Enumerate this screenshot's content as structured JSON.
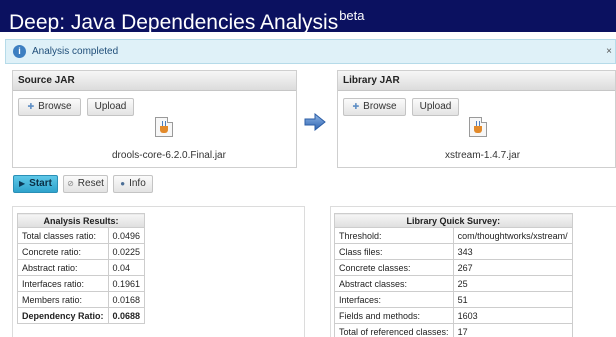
{
  "header": {
    "title": "Deep: Java Dependencies Analysis",
    "badge": "beta"
  },
  "notice": {
    "message": "Analysis completed",
    "close": "×"
  },
  "source_panel": {
    "title": "Source JAR",
    "browse_label": "Browse",
    "upload_label": "Upload",
    "file_name": "drools-core-6.2.0.Final.jar"
  },
  "library_panel": {
    "title": "Library JAR",
    "browse_label": "Browse",
    "upload_label": "Upload",
    "file_name": "xstream-1.4.7.jar"
  },
  "actions": {
    "start_label": "Start",
    "reset_label": "Reset",
    "info_label": "Info"
  },
  "results": {
    "title": "Analysis Results:",
    "rows": [
      {
        "label": "Total classes ratio:",
        "value": "0.0496"
      },
      {
        "label": "Concrete ratio:",
        "value": "0.0225"
      },
      {
        "label": "Abstract ratio:",
        "value": "0.04"
      },
      {
        "label": "Interfaces ratio:",
        "value": "0.1961"
      },
      {
        "label": "Members ratio:",
        "value": "0.0168"
      },
      {
        "label": "Dependency Ratio:",
        "value": "0.0688"
      }
    ]
  },
  "survey": {
    "title": "Library Quick Survey:",
    "rows": [
      {
        "label": "Threshold:",
        "value": "com/thoughtworks/xstream/"
      },
      {
        "label": "Class files:",
        "value": "343"
      },
      {
        "label": "Concrete classes:",
        "value": "267"
      },
      {
        "label": "Abstract classes:",
        "value": "25"
      },
      {
        "label": "Interfaces:",
        "value": "51"
      },
      {
        "label": "Fields and methods:",
        "value": "1603"
      },
      {
        "label": "Total of referenced classes:",
        "value": "17"
      }
    ]
  },
  "icons": {
    "info": "info-icon",
    "arrow": "arrow-right-icon",
    "jar": "java-jar-file-icon",
    "plus": "plus-icon",
    "play": "play-icon",
    "reset": "reset-icon"
  },
  "colors": {
    "header_bg": "#0b1160",
    "notice_bg": "#dff1f8",
    "start_button": "#2ea3cc",
    "arrow": "#3f78c2"
  }
}
